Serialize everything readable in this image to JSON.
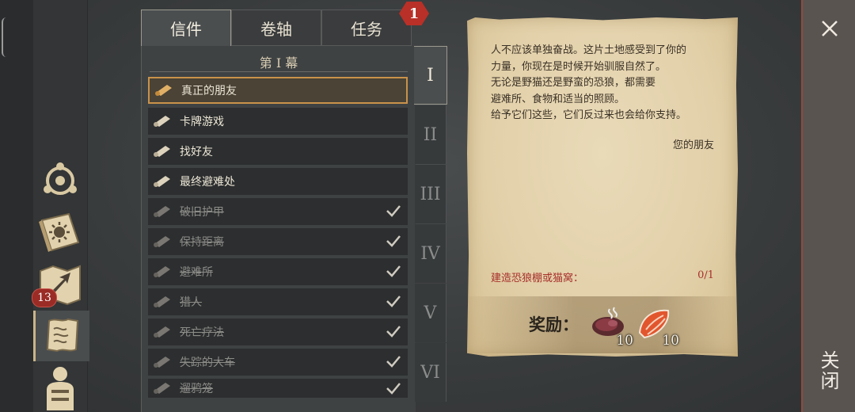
{
  "tabs": [
    {
      "label": "信件",
      "active": true
    },
    {
      "label": "卷轴",
      "active": false
    },
    {
      "label": "任务",
      "active": false
    }
  ],
  "tab_badge": "1",
  "act_title": "第 I 幕",
  "quests": [
    {
      "label": "真正的朋友",
      "selected": true,
      "done": false
    },
    {
      "label": "卡牌游戏",
      "selected": false,
      "done": false
    },
    {
      "label": "找好友",
      "selected": false,
      "done": false
    },
    {
      "label": "最终避难处",
      "selected": false,
      "done": false
    },
    {
      "label": "破旧护甲",
      "selected": false,
      "done": true
    },
    {
      "label": "保持距离",
      "selected": false,
      "done": true
    },
    {
      "label": "避难所",
      "selected": false,
      "done": true
    },
    {
      "label": "猎人",
      "selected": false,
      "done": true
    },
    {
      "label": "死亡疗法",
      "selected": false,
      "done": true
    },
    {
      "label": "失踪的大车",
      "selected": false,
      "done": true
    },
    {
      "label": "遛鸦笼",
      "selected": false,
      "done": true
    }
  ],
  "acts": [
    "I",
    "II",
    "III",
    "IV",
    "V",
    "VI"
  ],
  "active_act": "I",
  "letter": {
    "lines": [
      "人不应该单独奋战。这片土地感受到了你的",
      "力量，你现在是时候开始驯服自然了。",
      "无论是野猫还是野蛮的恐狼，都需要",
      "避难所、食物和适当的照顾。",
      "给予它们这些，它们反过来也会给你支持。"
    ],
    "signature": "您的朋友",
    "objective": "建造恐狼棚或猫窝：",
    "objective_progress": "0/1",
    "reward_label": "奖励：",
    "rewards": [
      {
        "icon": "raw-meat-icon",
        "count": "10"
      },
      {
        "icon": "fish-fillet-icon",
        "count": "10"
      }
    ]
  },
  "sidebar_badge": "13",
  "close_label": "关闭",
  "colors": {
    "accent_gold": "#c9924a",
    "badge_red": "#b83027",
    "objective_red": "#a7302b",
    "parchment": "#e2d0a9"
  }
}
